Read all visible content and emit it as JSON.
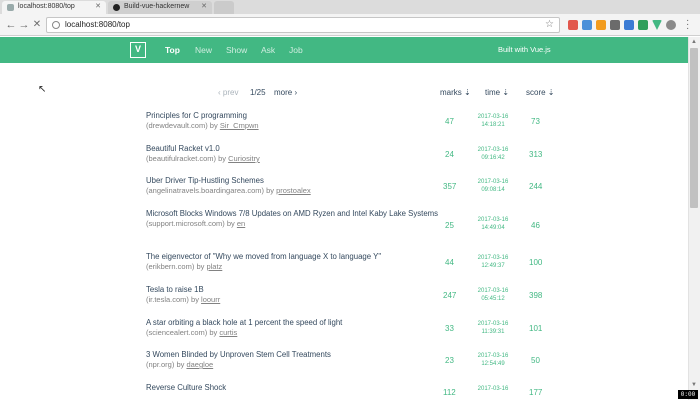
{
  "browser": {
    "tabs": [
      {
        "title": "localhost:8080/top"
      },
      {
        "title": "Build-vue-hackernew"
      }
    ],
    "url": "localhost:8080/top"
  },
  "header": {
    "logo": "V",
    "nav": [
      "Top",
      "New",
      "Show",
      "Ask",
      "Job"
    ],
    "built_with": "Built with Vue.js"
  },
  "pager": {
    "prev": "‹ prev",
    "page": "1/25",
    "more": "more ›"
  },
  "columns": {
    "marks": "marks ⇣",
    "time": "time ⇣",
    "score": "score ⇣"
  },
  "by_label": "by",
  "items": [
    {
      "title": "Principles for C programming",
      "domain": "(drewdevault.com)",
      "user": "Sir_Cmpwn",
      "marks": "47",
      "date": "2017-03-16",
      "time": "14:18:21",
      "score": "73"
    },
    {
      "title": "Beautiful Racket v1.0",
      "domain": "(beautifulracket.com)",
      "user": "Curiositry",
      "marks": "24",
      "date": "2017-03-16",
      "time": "09:16:42",
      "score": "313"
    },
    {
      "title": "Uber Driver Tip-Hustling Schemes",
      "domain": "(angelinatravels.boardingarea.com)",
      "user": "prostoalex",
      "marks": "357",
      "date": "2017-03-16",
      "time": "09:08:14",
      "score": "244"
    },
    {
      "title": "Microsoft Blocks Windows 7/8 Updates on AMD Ryzen and Intel Kaby Lake Systems",
      "domain": "(support.microsoft.com)",
      "user": "en",
      "marks": "25",
      "date": "2017-03-16",
      "time": "14:49:04",
      "score": "46"
    },
    {
      "title": "The eigenvector of \"Why we moved from language X to language Y\"",
      "domain": "(erikbern.com)",
      "user": "platz",
      "marks": "44",
      "date": "2017-03-16",
      "time": "12:49:37",
      "score": "100"
    },
    {
      "title": "Tesla to raise 1B",
      "domain": "(ir.tesla.com)",
      "user": "loourr",
      "marks": "247",
      "date": "2017-03-16",
      "time": "05:45:12",
      "score": "398"
    },
    {
      "title": "A star orbiting a black hole at 1 percent the speed of light",
      "domain": "(sciencealert.com)",
      "user": "curtis",
      "marks": "33",
      "date": "2017-03-16",
      "time": "11:39:31",
      "score": "101"
    },
    {
      "title": "3 Women Blinded by Unproven Stem Cell Treatments",
      "domain": "(npr.org)",
      "user": "daegloe",
      "marks": "23",
      "date": "2017-03-16",
      "time": "12:54:49",
      "score": "50"
    },
    {
      "title": "Reverse Culture Shock",
      "domain": "",
      "user": "",
      "marks": "112",
      "date": "2017-03-16",
      "time": "",
      "score": "177"
    }
  ],
  "recorder_badge": "0:00"
}
